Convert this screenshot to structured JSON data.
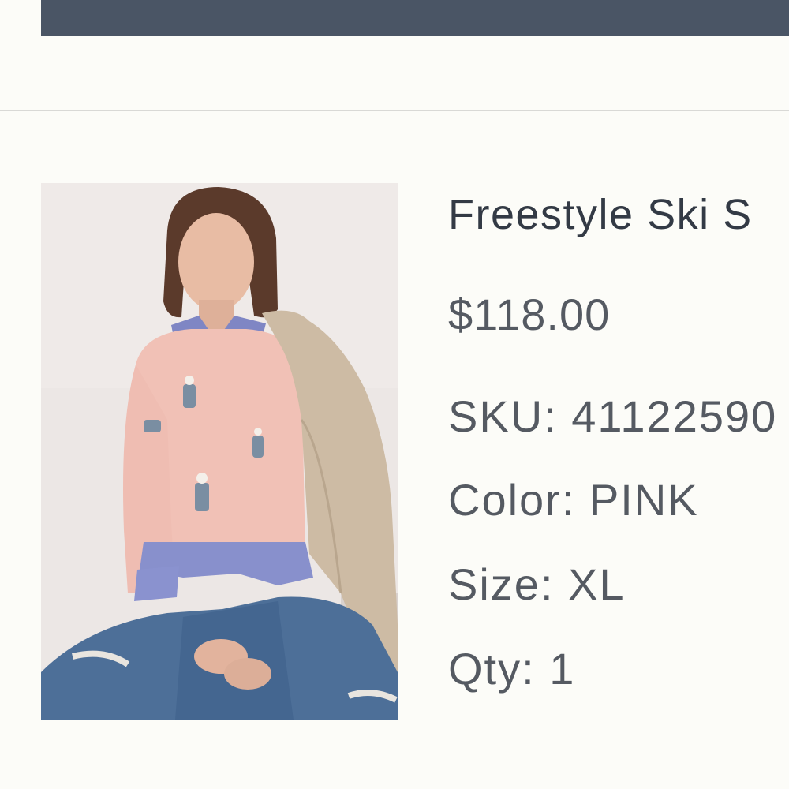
{
  "colors": {
    "header_bar": "#4a5565",
    "background": "#fcfcf8",
    "title_text": "#333a45",
    "body_text": "#555a62"
  },
  "product": {
    "title": "Freestyle Ski S",
    "price": "$118.00",
    "image": "product-photo",
    "sku_label": "SKU:",
    "sku_value": "41122590",
    "color_label": "Color:",
    "color_value": "PINK",
    "size_label": "Size:",
    "size_value": "XL",
    "qty_label": "Qty:",
    "qty_value": "1"
  }
}
